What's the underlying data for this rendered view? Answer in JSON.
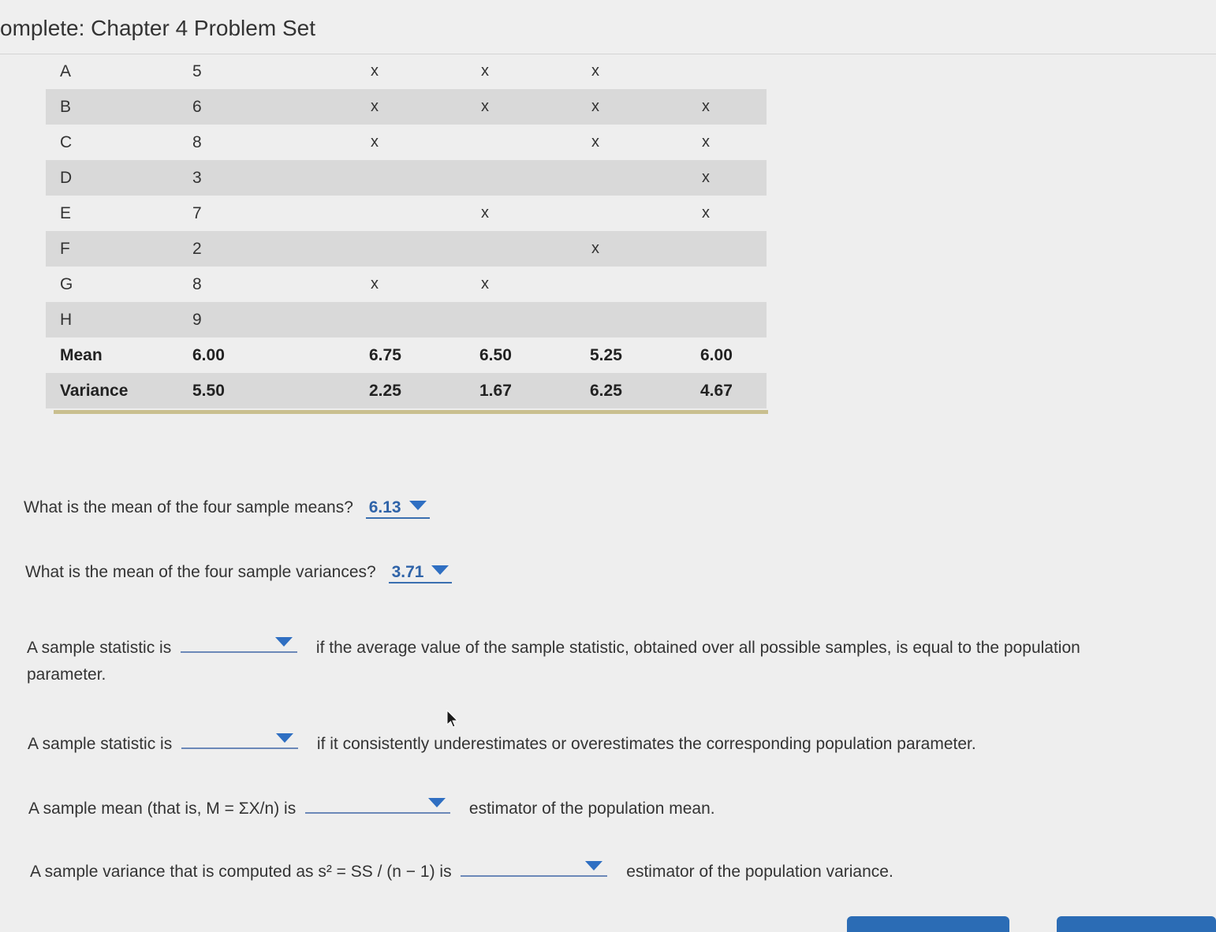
{
  "header": {
    "title": "omplete: Chapter 4 Problem Set"
  },
  "table": {
    "rows": [
      {
        "label": "A",
        "value": "5",
        "marks": [
          "x",
          "x",
          "x",
          ""
        ]
      },
      {
        "label": "B",
        "value": "6",
        "marks": [
          "x",
          "x",
          "x",
          "x"
        ]
      },
      {
        "label": "C",
        "value": "8",
        "marks": [
          "x",
          "",
          "x",
          "x"
        ]
      },
      {
        "label": "D",
        "value": "3",
        "marks": [
          "",
          "",
          "",
          "x"
        ]
      },
      {
        "label": "E",
        "value": "7",
        "marks": [
          "",
          "x",
          "",
          "x"
        ]
      },
      {
        "label": "F",
        "value": "2",
        "marks": [
          "",
          "",
          "x",
          ""
        ]
      },
      {
        "label": "G",
        "value": "8",
        "marks": [
          "x",
          "x",
          "",
          ""
        ]
      },
      {
        "label": "H",
        "value": "9",
        "marks": [
          "",
          "",
          "",
          ""
        ]
      }
    ],
    "mean_row": {
      "label": "Mean",
      "values": [
        "6.00",
        "6.75",
        "6.50",
        "5.25",
        "6.00"
      ]
    },
    "variance_row": {
      "label": "Variance",
      "values": [
        "5.50",
        "2.25",
        "1.67",
        "6.25",
        "4.67"
      ]
    }
  },
  "questions": {
    "q1": {
      "text": "What is the mean of the four sample means?",
      "answer": "6.13"
    },
    "q2": {
      "text": "What is the mean of the four sample variances?",
      "answer": "3.71"
    },
    "q3": {
      "before": "A sample statistic is",
      "after": "if the average value of the sample statistic, obtained over all possible samples, is equal to the population",
      "continued": "parameter."
    },
    "q4": {
      "before": "A sample statistic is",
      "after": "if it consistently underestimates or overestimates the corresponding population parameter."
    },
    "q5": {
      "before": "A sample mean (that is, M = ΣX/n) is",
      "after": "estimator of the population mean."
    },
    "q6": {
      "before": "A sample variance that is computed as s² = SS / (n − 1) is",
      "after": "estimator of the population variance."
    }
  },
  "icons": {
    "dropdown": "caret-down-icon",
    "pointer": "mouse-pointer-icon"
  },
  "colors": {
    "accent": "#2f63a8",
    "shade": "#d9d9d9",
    "rule": "#c9bf8f"
  }
}
